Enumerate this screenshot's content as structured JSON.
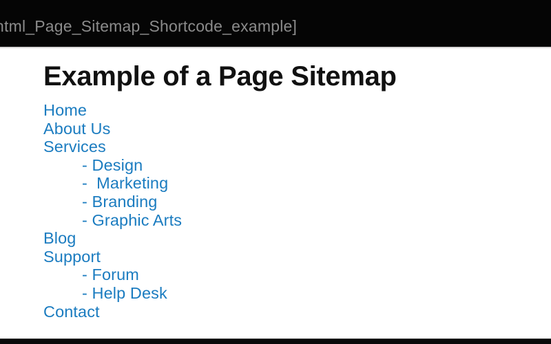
{
  "titlebar": {
    "text": "html_Page_Sitemap_Shortcode_example]",
    "background": "#050505",
    "text_color": "#8b8b8b"
  },
  "page": {
    "heading": "Example of a Page Sitemap",
    "heading_color": "#111111",
    "background": "#ffffff",
    "link_color": "#1b7cc0"
  },
  "sitemap": {
    "items": [
      {
        "label": "Home",
        "level": 1
      },
      {
        "label": "About Us",
        "level": 1
      },
      {
        "label": "Services",
        "level": 1
      },
      {
        "label": "- Design",
        "level": 2
      },
      {
        "label": "-  Marketing",
        "level": 2
      },
      {
        "label": "- Branding",
        "level": 2
      },
      {
        "label": "- Graphic Arts",
        "level": 2
      },
      {
        "label": "Blog",
        "level": 1
      },
      {
        "label": "Support",
        "level": 1
      },
      {
        "label": "- Forum",
        "level": 2
      },
      {
        "label": "- Help Desk",
        "level": 2
      },
      {
        "label": "Contact",
        "level": 1
      }
    ]
  },
  "bottombar": {
    "background": "#0a0a0a"
  }
}
